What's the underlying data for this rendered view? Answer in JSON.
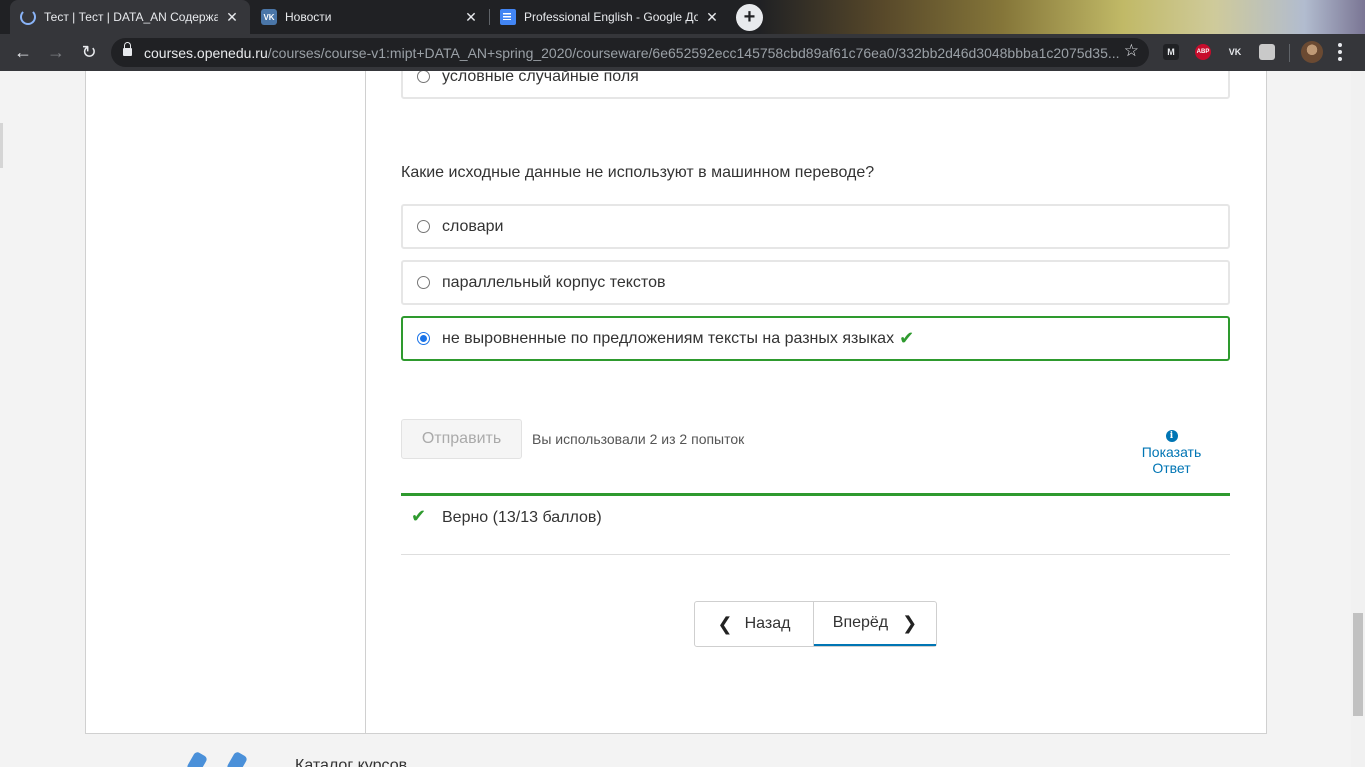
{
  "browser": {
    "tabs": [
      {
        "title": "Тест | Тест | DATA_AN Содержание",
        "icon": "loading-spinner-icon",
        "close": "✕"
      },
      {
        "title": "Новости",
        "icon": "vk-icon",
        "close": "✕"
      },
      {
        "title": "Professional English - Google Документы",
        "icon": "google-docs-icon",
        "close": "✕"
      }
    ],
    "new_tab": "+",
    "url_host": "courses.openedu.ru",
    "url_path": "/courses/course-v1:mipt+DATA_AN+spring_2020/courseware/6e652592ecc145758cbd89af61c76ea0/332bb2d46d3048bbba1c2075d35...",
    "extensions": {
      "m": "M",
      "abp": "ABP",
      "vk": "VK"
    }
  },
  "problem": {
    "prev_option": "условные случайные поля",
    "question": "Какие исходные данные не используют в машинном переводе?",
    "options": [
      {
        "label": "словари",
        "checked": false
      },
      {
        "label": "параллельный корпус текстов",
        "checked": false
      },
      {
        "label": "не выровненные по предложениям тексты на разных языках",
        "checked": true,
        "correct": true
      }
    ],
    "submit_label": "Отправить",
    "attempts": "Вы использовали 2 из 2 попыток",
    "show_answer_line1": "Показать",
    "show_answer_line2": "Ответ",
    "result": "Верно (13/13 баллов)"
  },
  "navigation": {
    "prev_label": "Назад",
    "next_label": "Вперёд"
  },
  "footer": {
    "link": "Каталог курсов"
  },
  "colors": {
    "correct": "#2e9a2e",
    "link": "#0075b4"
  }
}
